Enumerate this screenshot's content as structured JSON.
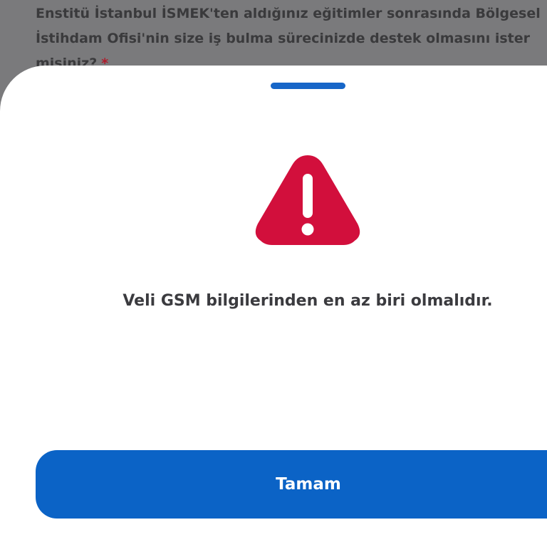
{
  "background_form": {
    "question_line_1": "Enstitü İstanbul İSMEK'ten aldığınız eğitimler sonrasında Bölgesel",
    "question_line_2": "İstihdam Ofisi'nin size iş bulma sürecinizde destek olmasını ister",
    "question_line_3": "misiniz?",
    "required_marker": "*"
  },
  "alert_sheet": {
    "icon": "warning-triangle-icon",
    "icon_color": "#d20f3c",
    "message": "Veli GSM bilgilerinden en az biri olmalıdır.",
    "confirm_label": "Tamam",
    "confirm_color": "#0b63c6"
  }
}
